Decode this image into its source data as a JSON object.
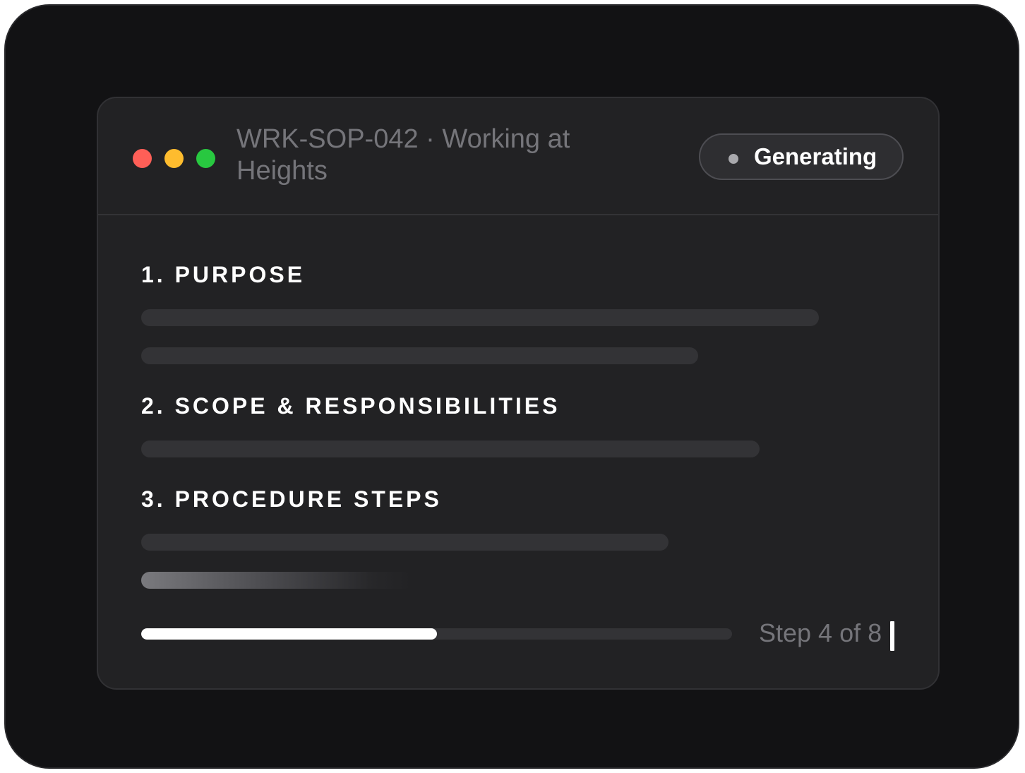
{
  "window": {
    "title": "WRK-SOP-042 · Working at Heights",
    "controls": [
      "close",
      "minimize",
      "maximize"
    ]
  },
  "status": {
    "label": "Generating",
    "indicator": "status-dot"
  },
  "sections": [
    {
      "heading": "1. PURPOSE"
    },
    {
      "heading": "2. SCOPE & RESPONSIBILITIES"
    },
    {
      "heading": "3. PROCEDURE STEPS"
    }
  ],
  "progress": {
    "current_step": 4,
    "total_steps": 8,
    "fraction": 0.5,
    "label": "Step 4 of 8"
  },
  "colors": {
    "close": "#ff5f57",
    "minimize": "#febc2e",
    "maximize": "#28c840",
    "progress_fill": "#ffffff",
    "placeholder_line": "#333336"
  }
}
